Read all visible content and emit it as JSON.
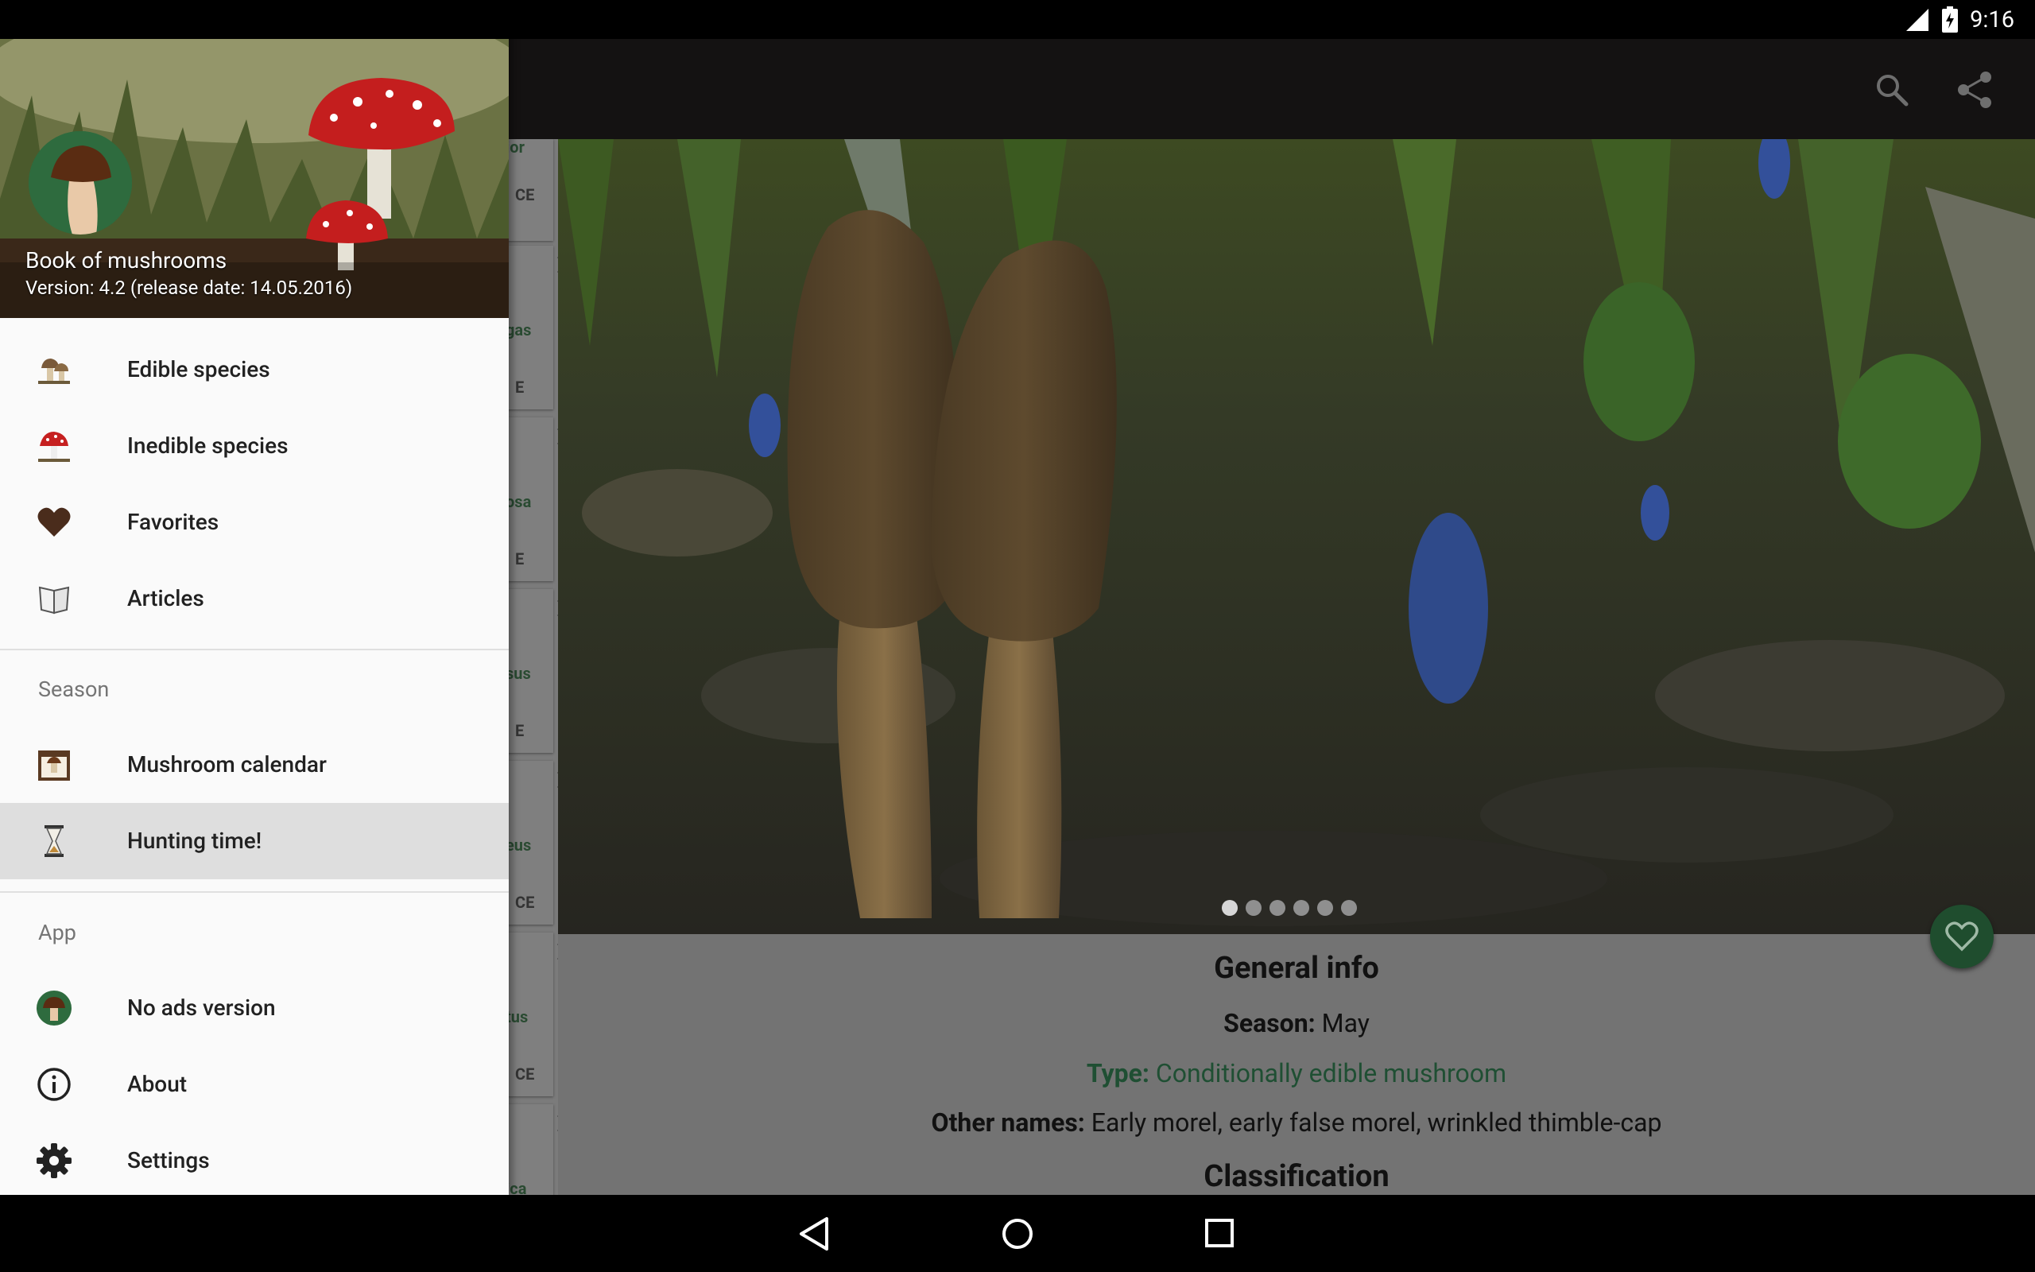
{
  "status_bar": {
    "time": "9:16"
  },
  "drawer": {
    "app_title": "Book of mushrooms",
    "version": "Version: 4.2 (release date: 14.05.2016)",
    "items": [
      {
        "label": "Edible species",
        "icon": "edible-mushrooms-icon"
      },
      {
        "label": "Inedible species",
        "icon": "inedible-mushroom-icon"
      },
      {
        "label": "Favorites",
        "icon": "heart-icon"
      },
      {
        "label": "Articles",
        "icon": "book-icon"
      }
    ],
    "season_section": "Season",
    "season_items": [
      {
        "label": "Mushroom calendar",
        "icon": "calendar-icon"
      },
      {
        "label": "Hunting time!",
        "icon": "hourglass-icon",
        "selected": true
      }
    ],
    "app_section": "App",
    "app_items": [
      {
        "label": "No ads version",
        "icon": "mushroom-badge-icon"
      },
      {
        "label": "About",
        "icon": "info-icon"
      },
      {
        "label": "Settings",
        "icon": "gear-icon"
      }
    ]
  },
  "background_list": {
    "fragments": [
      {
        "name": "ior",
        "type": "CE"
      },
      {
        "name": "gas",
        "type": "E"
      },
      {
        "name": "osa",
        "type": "E"
      },
      {
        "name": "sus",
        "type": "E"
      },
      {
        "name": "eus",
        "type": "E"
      },
      {
        "name": "tus",
        "type": "CE"
      },
      {
        "name": "ica",
        "type": ""
      }
    ]
  },
  "gallery": {
    "page_count": 6,
    "active_index": 0
  },
  "info": {
    "heading": "General info",
    "season_label": "Season:",
    "season_value": "May",
    "type_label": "Type:",
    "type_value": "Conditionally edible mushroom",
    "other_names_label": "Other names:",
    "other_names_value": "Early morel, early false morel, wrinkled thimble-cap",
    "classification_heading": "Classification"
  },
  "colors": {
    "accent_green": "#1f4d2e",
    "drawer_bg": "#fafafa",
    "selected_row": "#dedede"
  }
}
